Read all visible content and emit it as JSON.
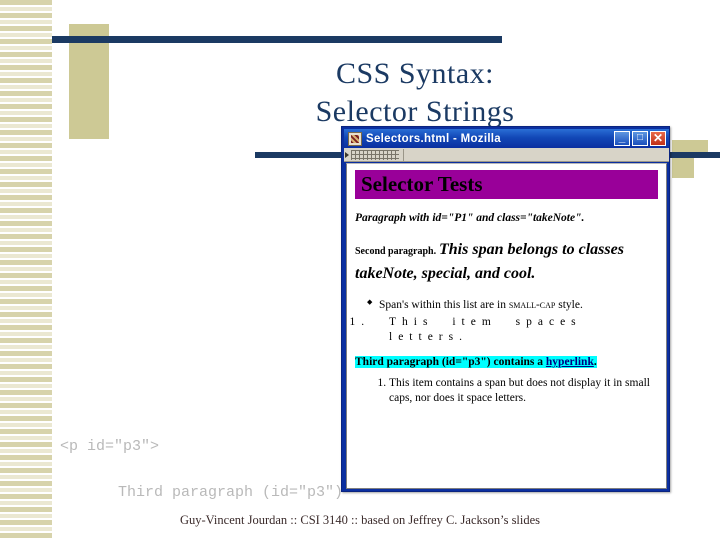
{
  "slide": {
    "title_lines": [
      "CSS Syntax:",
      "Selector Strings"
    ],
    "footer": "Guy-Vincent Jourdan :: CSI 3140 :: based on Jeffrey C. Jackson’s slides",
    "ghost_code_line1": "<p id=\"p3\">",
    "ghost_code_line2": "Third paragraph (id=\"p3\")"
  },
  "colors": {
    "navy_rule": "#1b3a63",
    "khaki": "#cdc995",
    "stripe": "#d7d3ab",
    "title": "#1b3a63",
    "heading_bg": "#990099",
    "highlight_bg": "#00ffff",
    "link": "#000080",
    "titlebar_blue": "#0b2fa0"
  },
  "browser": {
    "window_title": "Selectors.html - Mozilla",
    "app_icon": "mozilla-lizard-icon",
    "buttons": {
      "minimize": "_",
      "maximize": "□",
      "close": "✕"
    },
    "toolbar": {
      "grip": "toolbar-grip-handle"
    },
    "page": {
      "h1": "Selector Tests",
      "p1": "Paragraph with id=\"P1\" and class=\"takeNote\".",
      "p2_lead": "Second paragraph.",
      "p2_span": "This span belongs to classes takeNote, special, and cool.",
      "bullet1_pre": "Span's within this list are in ",
      "bullet1_smallcap": "small-cap",
      "bullet1_post": " style.",
      "inner_item_spaced": "This item spaces letters.",
      "p3_pre": "Third paragraph (id=\"p3\") contains a ",
      "p3_link": "hyperlink",
      "p3_post": ".",
      "last_item": "This item contains a span but does not display it in small caps, nor does it space letters."
    }
  }
}
